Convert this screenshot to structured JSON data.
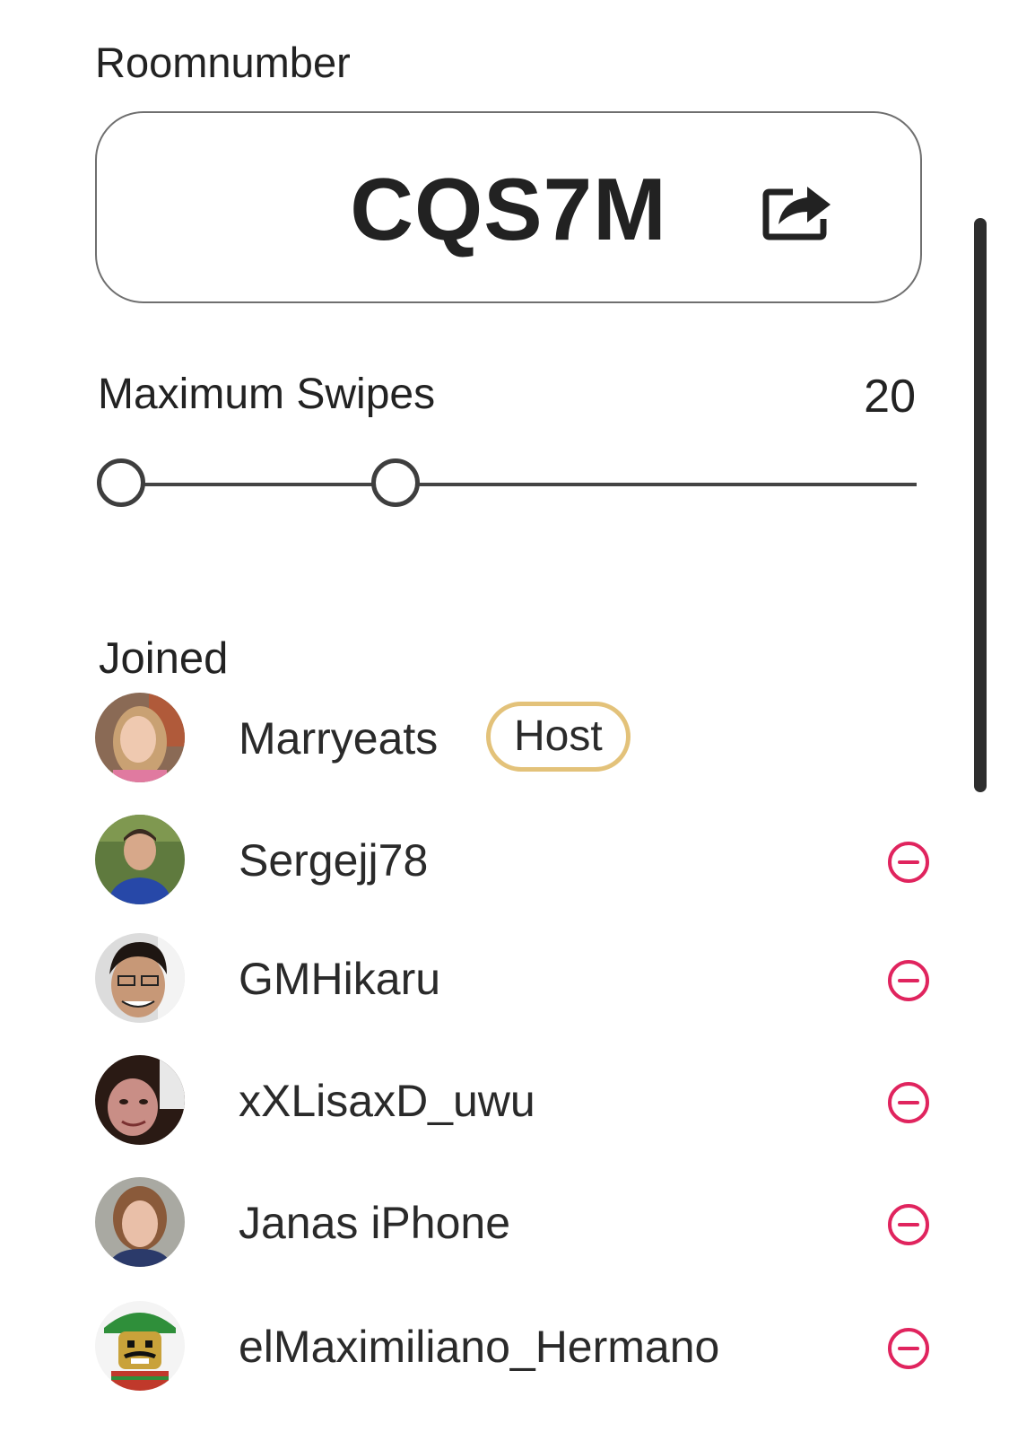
{
  "room": {
    "label": "Roomnumber",
    "code": "CQS7M",
    "share_icon": "share-icon"
  },
  "swipes": {
    "label": "Maximum Swipes",
    "value": "20"
  },
  "joined": {
    "label": "Joined",
    "host_badge": "Host",
    "members": [
      {
        "name": "Marryeats",
        "is_host": true
      },
      {
        "name": "Sergejj78",
        "is_host": false
      },
      {
        "name": "GMHikaru",
        "is_host": false
      },
      {
        "name": "xXLisaxD_uwu",
        "is_host": false
      },
      {
        "name": "Janas iPhone",
        "is_host": false
      },
      {
        "name": "elMaximiliano_Hermano",
        "is_host": false
      }
    ]
  },
  "colors": {
    "accent_remove": "#e0245e",
    "host_border": "#e3c27a",
    "text": "#222222"
  }
}
